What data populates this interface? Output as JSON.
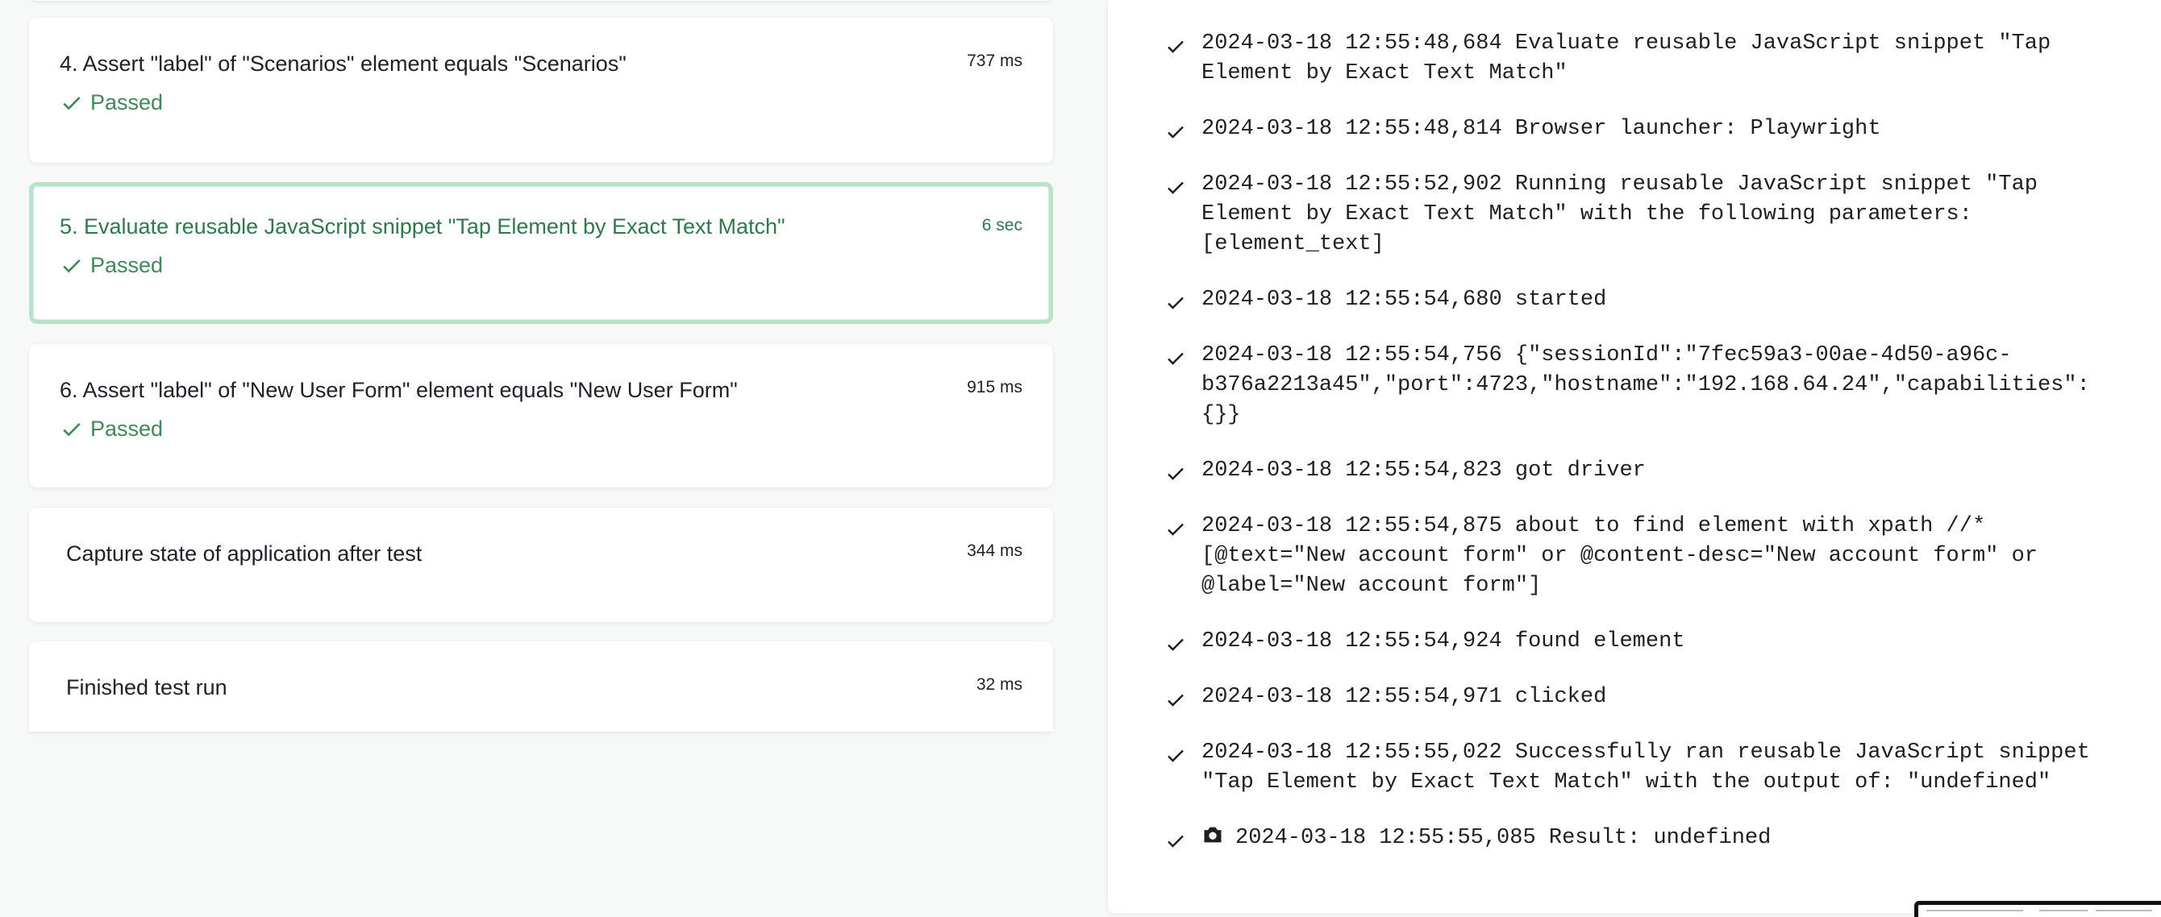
{
  "steps": [
    {
      "title": "4. Assert \"label\" of \"Scenarios\" element equals \"Scenarios\"",
      "time": "737 ms",
      "status": "Passed"
    },
    {
      "title": "5. Evaluate reusable JavaScript snippet \"Tap Element by Exact Text Match\"",
      "time": "6 sec",
      "status": "Passed"
    },
    {
      "title": "6. Assert \"label\" of \"New User Form\" element equals \"New User Form\"",
      "time": "915 ms",
      "status": "Passed"
    },
    {
      "title": "Capture state of application after test",
      "time": "344 ms"
    },
    {
      "title": "Finished test run",
      "time": "32 ms"
    }
  ],
  "log": [
    {
      "lines": [
        "2024-03-18 12:55:48,684 Evaluate reusable JavaScript snippet \"Tap",
        "Element by Exact Text Match\""
      ]
    },
    {
      "lines": [
        "2024-03-18 12:55:48,814 Browser launcher: Playwright"
      ]
    },
    {
      "lines": [
        "2024-03-18 12:55:52,902 Running reusable JavaScript snippet \"Tap",
        "Element by Exact Text Match\" with the following parameters:",
        "[element_text]"
      ]
    },
    {
      "lines": [
        "2024-03-18 12:55:54,680 started"
      ]
    },
    {
      "lines": [
        "2024-03-18 12:55:54,756 {\"sessionId\":\"7fec59a3-00ae-4d50-a96c-",
        "b376a2213a45\",\"port\":4723,\"hostname\":\"192.168.64.24\",\"capabilities\":",
        "{}}"
      ]
    },
    {
      "lines": [
        "2024-03-18 12:55:54,823 got driver"
      ]
    },
    {
      "lines": [
        "2024-03-18 12:55:54,875 about to find element with xpath //*",
        "[@text=\"New account form\" or @content-desc=\"New account form\" or",
        "@label=\"New account form\"]"
      ]
    },
    {
      "lines": [
        "2024-03-18 12:55:54,924 found element"
      ]
    },
    {
      "lines": [
        "2024-03-18 12:55:54,971 clicked"
      ]
    },
    {
      "lines": [
        "2024-03-18 12:55:55,022 Successfully ran reusable JavaScript snippet",
        "\"Tap Element by Exact Text Match\" with the output of: \"undefined\""
      ]
    },
    {
      "lines": [
        "2024-03-18 12:55:55,085 Result: undefined"
      ],
      "icon": "camera-icon"
    }
  ],
  "colors": {
    "passed": "#3d8b57",
    "selected_border": "#b9e2cb",
    "text": "#1d2129"
  }
}
